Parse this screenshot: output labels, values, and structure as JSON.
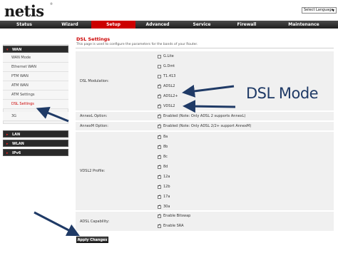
{
  "header": {
    "logo": "netis",
    "logo_mark": "®",
    "language_select": "Select Language"
  },
  "nav": {
    "items": [
      {
        "label": "Status"
      },
      {
        "label": "Wizard"
      },
      {
        "label": "Setup",
        "active": true
      },
      {
        "label": "Advanced"
      },
      {
        "label": "Service"
      },
      {
        "label": "Firewall"
      },
      {
        "label": "Maintenance"
      }
    ],
    "active_color": "#cc0000"
  },
  "sidebar": {
    "wan_group": "WAN",
    "wan_items": [
      "WAN Mode",
      "Ethernet WAN",
      "PTM WAN",
      "ATM WAN",
      "ATM Settings",
      "DSL Settings",
      "3G"
    ],
    "active_item": "DSL Settings",
    "groups": [
      "LAN",
      "WLAN",
      "IPv6"
    ]
  },
  "page": {
    "title": "DSL Settings",
    "description": "This page is used to configure the parameters for the bands of your Router."
  },
  "dsl_modulation": {
    "label": "DSL Modulation:",
    "options": [
      {
        "label": "G.Lite",
        "checked": false
      },
      {
        "label": "G.Dmt",
        "checked": false
      },
      {
        "label": "T1.413",
        "checked": false
      },
      {
        "label": "ADSL2",
        "checked": true
      },
      {
        "label": "ADSL2+",
        "checked": true
      },
      {
        "label": "VDSL2",
        "checked": true
      }
    ]
  },
  "annex_l": {
    "label": "AnnexL Option:",
    "text": "Enabled   (Note: Only ADSL 2 supports AnnexL)",
    "checked": true
  },
  "annex_m": {
    "label": "AnnexM Option:",
    "text": "Enabled   (Note: Only ADSL 2/2+ support AnnexM)",
    "checked": true
  },
  "vdsl2_profile": {
    "label": "VDSL2 Profile:",
    "options": [
      {
        "label": "8a",
        "checked": true
      },
      {
        "label": "8b",
        "checked": true
      },
      {
        "label": "8c",
        "checked": true
      },
      {
        "label": "8d",
        "checked": true
      },
      {
        "label": "12a",
        "checked": true
      },
      {
        "label": "12b",
        "checked": true
      },
      {
        "label": "17a",
        "checked": true
      },
      {
        "label": "30a",
        "checked": true
      }
    ]
  },
  "adsl_capability": {
    "label": "ADSL Capability:",
    "options": [
      {
        "label": "Enable Bitswap",
        "checked": true
      },
      {
        "label": "Enable SRA",
        "checked": true
      }
    ]
  },
  "apply_button": "Apply Changes",
  "annotation": {
    "text": "DSL Mode",
    "color": "#1f3a66"
  }
}
